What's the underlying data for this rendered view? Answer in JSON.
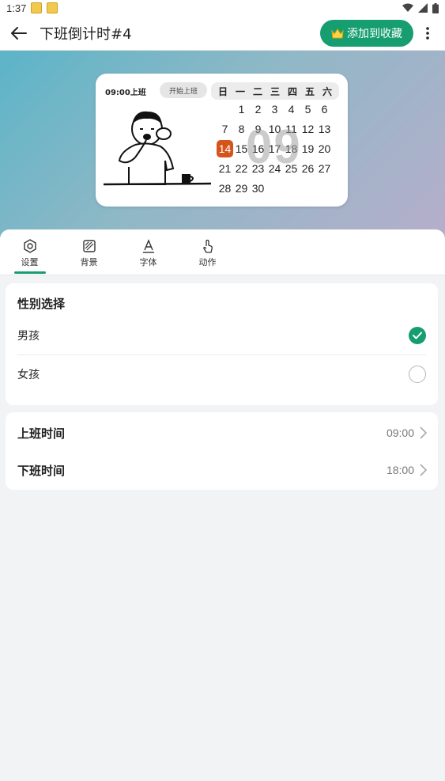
{
  "status_bar": {
    "time": "1:37"
  },
  "app_bar": {
    "title": "下班倒计时#4",
    "favorite_label": "添加到收藏",
    "accent": "#169e70"
  },
  "widget": {
    "start_time": "09:00上班",
    "start_button": "开始上班",
    "weekdays": [
      "日",
      "一",
      "二",
      "三",
      "四",
      "五",
      "六"
    ],
    "calendar_rows": [
      [
        "",
        "1",
        "2",
        "3",
        "4",
        "5",
        "6"
      ],
      [
        "7",
        "8",
        "9",
        "10",
        "11",
        "12",
        "13"
      ],
      [
        "14",
        "15",
        "16",
        "17",
        "18",
        "19",
        "20"
      ],
      [
        "21",
        "22",
        "23",
        "24",
        "25",
        "26",
        "27"
      ],
      [
        "28",
        "29",
        "30",
        "",
        "",
        "",
        ""
      ]
    ],
    "today": "14",
    "today_color": "#d4541c",
    "countdown": "09"
  },
  "tabs": [
    {
      "label": "设置",
      "icon": "hexagon-icon",
      "active": true
    },
    {
      "label": "背景",
      "icon": "background-pattern-icon",
      "active": false
    },
    {
      "label": "字体",
      "icon": "font-icon",
      "active": false
    },
    {
      "label": "动作",
      "icon": "tap-hand-icon",
      "active": false
    }
  ],
  "gender": {
    "heading": "性别选择",
    "options": [
      {
        "label": "男孩",
        "selected": true
      },
      {
        "label": "女孩",
        "selected": false
      }
    ]
  },
  "times": [
    {
      "label": "上班时间",
      "value": "09:00"
    },
    {
      "label": "下班时间",
      "value": "18:00"
    }
  ]
}
